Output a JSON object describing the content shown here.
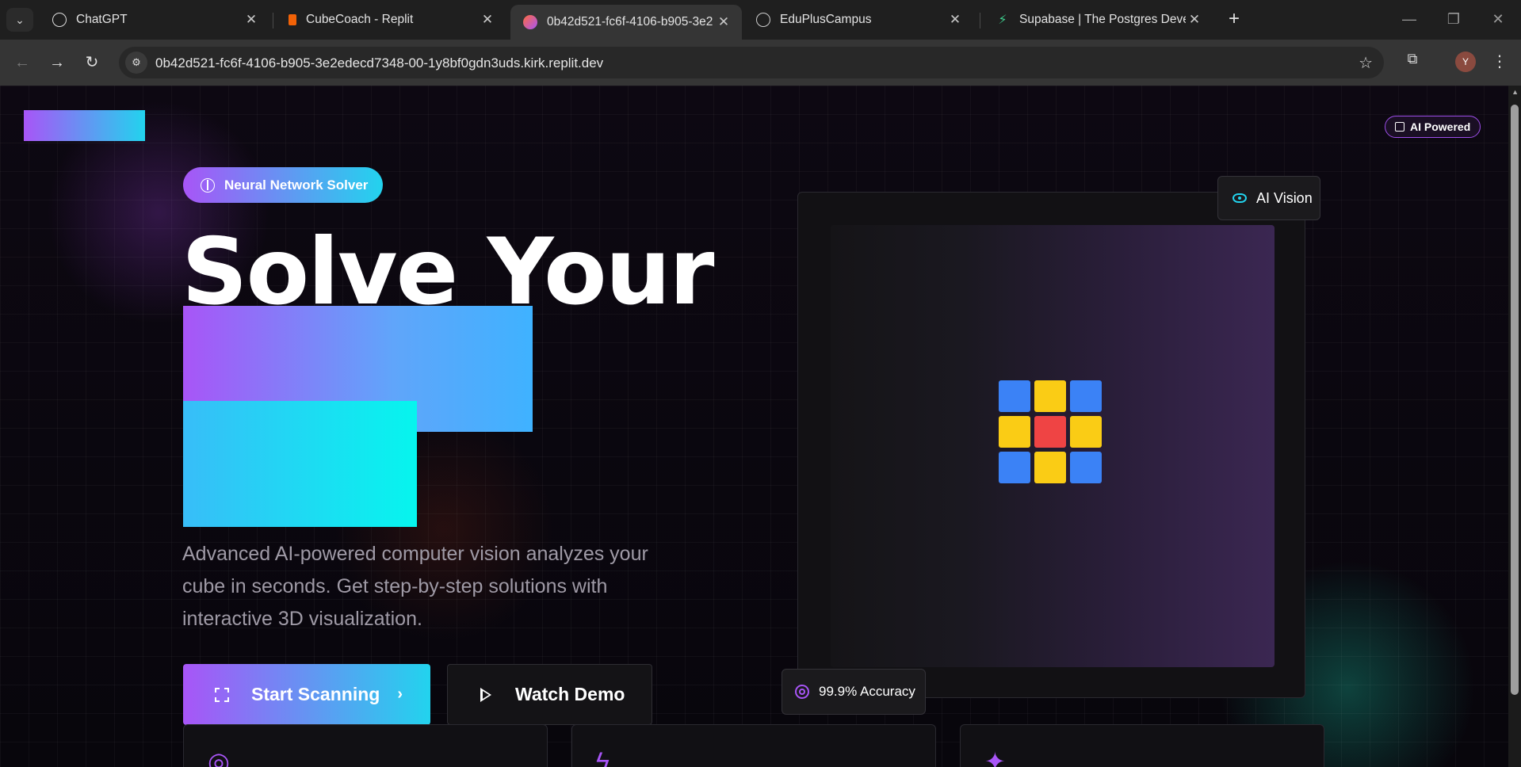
{
  "browser": {
    "tabs": [
      {
        "title": "ChatGPT",
        "icon": "chatgpt-icon"
      },
      {
        "title": "CubeCoach - Replit",
        "icon": "replit-icon"
      },
      {
        "title": "0b42d521-fc6f-4106-b905-3e2",
        "icon": "replit-dev-icon",
        "active": true
      },
      {
        "title": "EduPlusCampus",
        "icon": "globe-icon"
      },
      {
        "title": "Supabase | The Postgres Develo",
        "icon": "supabase-icon"
      }
    ],
    "url": "0b42d521-fc6f-4106-b905-3e2edecd7348-00-1y8bf0gdn3uds.kirk.replit.dev",
    "profile_initial": "Y"
  },
  "page": {
    "ai_badge": "AI Powered",
    "hero_badge": "Neural Network Solver",
    "hero_title": "Solve Your",
    "hero_description": "Advanced AI-powered computer vision analyzes your cube in seconds. Get step-by-step solutions with interactive 3D visualization.",
    "primary_button": "Start Scanning",
    "secondary_button": "Watch Demo",
    "vision_label": "AI Vision",
    "accuracy_label": "99.9% Accuracy",
    "cube_colors": [
      "blue",
      "yellow",
      "blue",
      "yellow",
      "red",
      "yellow",
      "blue",
      "yellow",
      "blue"
    ]
  },
  "colors": {
    "accent_purple": "#a855f7",
    "accent_cyan": "#22d3ee",
    "cube_blue": "#3b82f6",
    "cube_yellow": "#facc15",
    "cube_red": "#ef4444"
  }
}
